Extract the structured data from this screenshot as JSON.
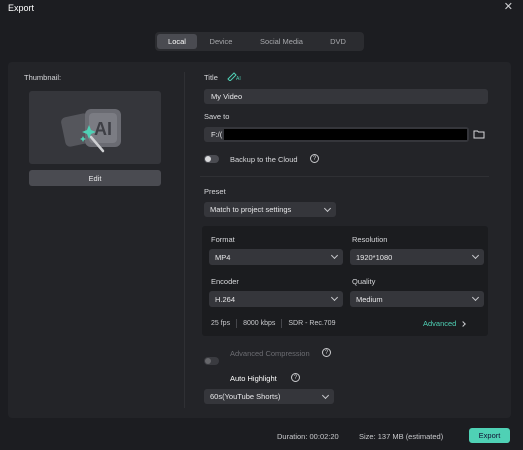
{
  "window": {
    "title": "Export"
  },
  "tabs": [
    "Local",
    "Device",
    "Social Media",
    "DVD"
  ],
  "thumbnail": {
    "label": "Thumbnail:",
    "edit_label": "Edit"
  },
  "title_field": {
    "label": "Title",
    "value": "My Video"
  },
  "save_to": {
    "label": "Save to",
    "path": "F:/("
  },
  "backup": {
    "label": "Backup to the Cloud",
    "enabled": false
  },
  "preset": {
    "label": "Preset",
    "value": "Match to project settings"
  },
  "format": {
    "label": "Format",
    "value": "MP4"
  },
  "resolution": {
    "label": "Resolution",
    "value": "1920*1080"
  },
  "encoder": {
    "label": "Encoder",
    "value": "H.264"
  },
  "quality": {
    "label": "Quality",
    "value": "Medium"
  },
  "stats": {
    "fps": "25 fps",
    "bitrate": "8000 kbps",
    "color": "SDR - Rec.709"
  },
  "advanced_label": "Advanced",
  "advanced_compression": {
    "label": "Advanced Compression",
    "enabled": false
  },
  "auto_highlight": {
    "label": "Auto Highlight",
    "enabled": true,
    "value": "60s(YouTube Shorts)"
  },
  "footer": {
    "duration": "Duration:  00:02:20",
    "size": "Size:  137 MB (estimated)",
    "export_label": "Export"
  },
  "colors": {
    "accent": "#4fd1b5",
    "panel": "#232428",
    "background": "#1c1d21"
  }
}
